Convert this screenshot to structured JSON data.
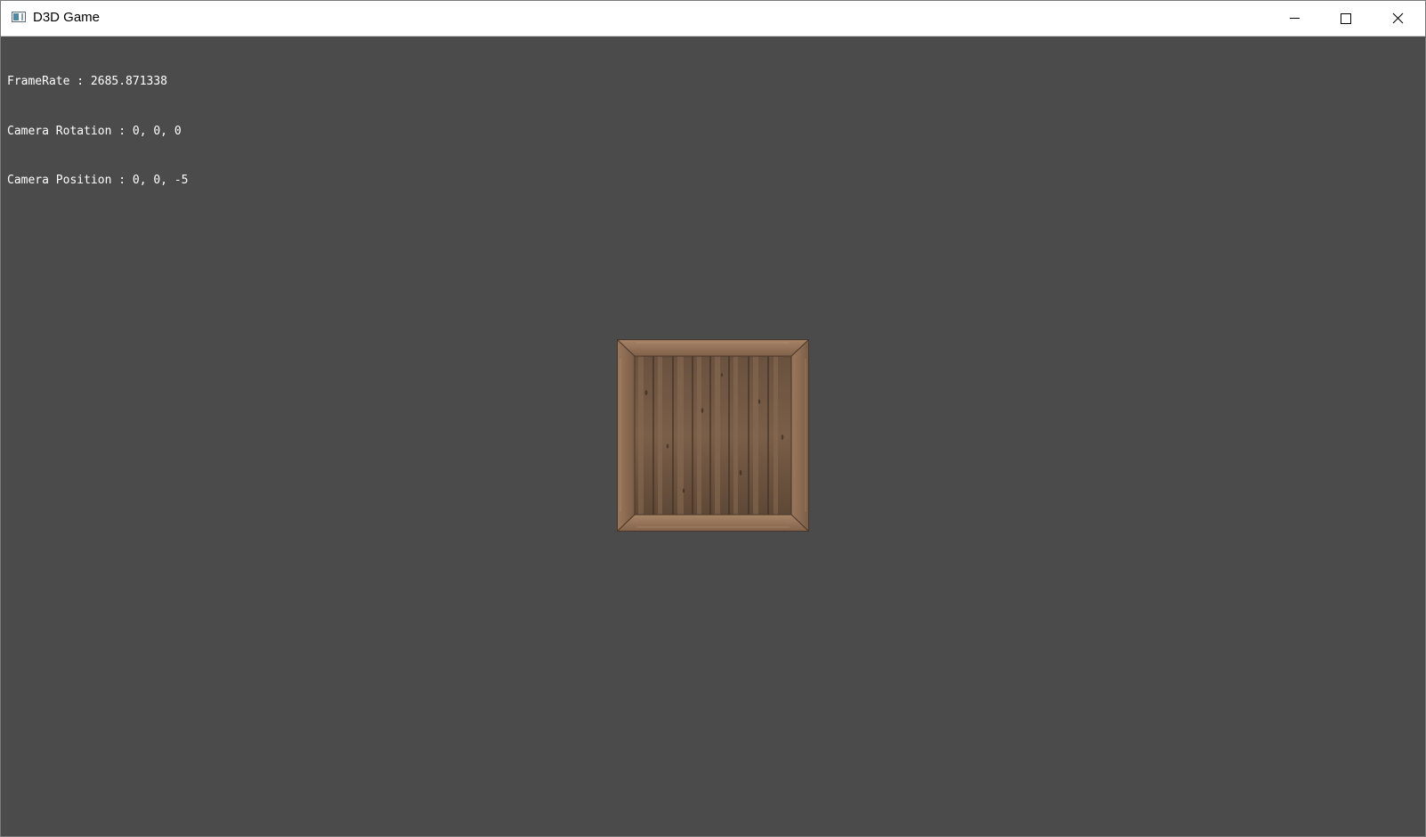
{
  "window": {
    "title": "D3D Game",
    "icon": "app-window-icon",
    "controls": {
      "minimize": "minimize-icon",
      "maximize": "maximize-icon",
      "close": "close-icon"
    }
  },
  "hud": {
    "framerate": "FrameRate : 2685.871338",
    "camera_rotation": "Camera Rotation : 0, 0, 0",
    "camera_position": "Camera Position : 0, 0, -5"
  },
  "scene": {
    "background_color": "#4b4b4b",
    "object": "wooden-crate"
  }
}
